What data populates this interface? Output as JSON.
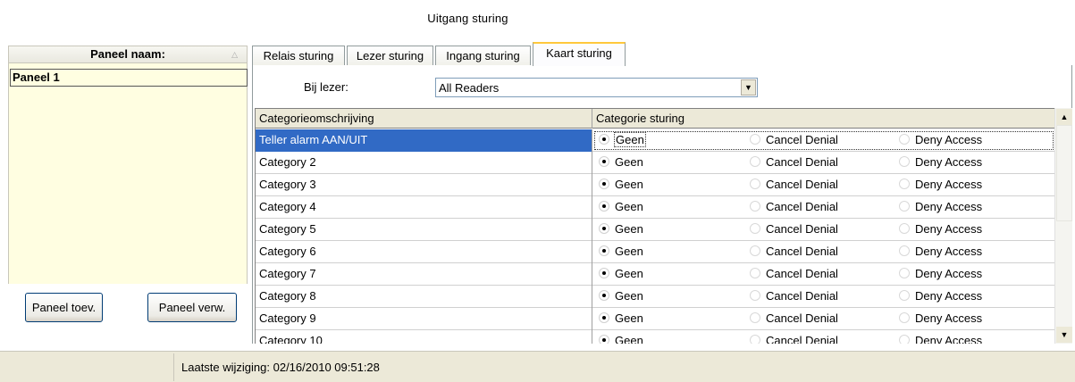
{
  "window": {
    "title": "Uitgang sturing"
  },
  "panels": {
    "header": "Paneel naam:",
    "items": [
      "Paneel 1"
    ],
    "add_button": "Paneel toev.",
    "remove_button": "Paneel verw."
  },
  "tabs": [
    {
      "label": "Relais sturing",
      "active": false
    },
    {
      "label": "Lezer sturing",
      "active": false
    },
    {
      "label": "Ingang sturing",
      "active": false
    },
    {
      "label": "Kaart sturing",
      "active": true
    }
  ],
  "reader": {
    "label": "Bij lezer:",
    "value": "All Readers"
  },
  "grid": {
    "columns": [
      "Categorieomschrijving",
      "Categorie sturing"
    ],
    "options": [
      "Geen",
      "Cancel Denial",
      "Deny Access"
    ],
    "rows": [
      {
        "name": "Teller alarm AAN/UIT",
        "selected": "Geen",
        "highlighted": true
      },
      {
        "name": "Category 2",
        "selected": "Geen"
      },
      {
        "name": "Category 3",
        "selected": "Geen"
      },
      {
        "name": "Category 4",
        "selected": "Geen"
      },
      {
        "name": "Category 5",
        "selected": "Geen"
      },
      {
        "name": "Category 6",
        "selected": "Geen"
      },
      {
        "name": "Category 7",
        "selected": "Geen"
      },
      {
        "name": "Category 8",
        "selected": "Geen"
      },
      {
        "name": "Category 9",
        "selected": "Geen"
      },
      {
        "name": "Category 10",
        "selected": "Geen"
      }
    ]
  },
  "status": {
    "text": "Laatste wijziging: 02/16/2010 09:51:28"
  },
  "colors": {
    "selection": "#316ac5",
    "active_tab_accent": "#ffc83c",
    "panel_list_bg": "#fffee1",
    "chrome_bg": "#ece9d8"
  }
}
